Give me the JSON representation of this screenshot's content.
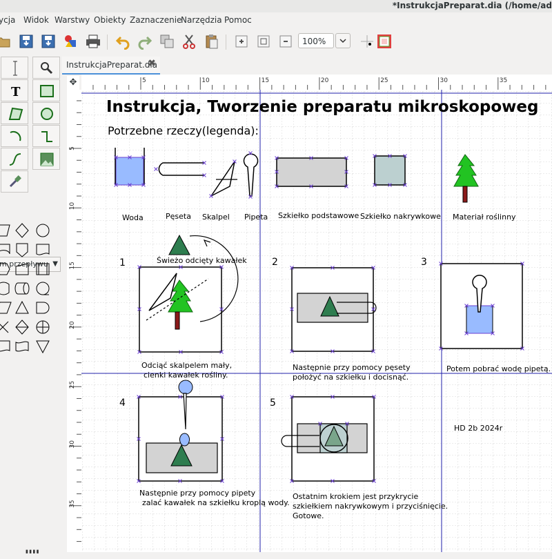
{
  "window": {
    "title": "*InstrukcjaPreparat.dia (/home/ad"
  },
  "menu": [
    "ycja",
    "Widok",
    "Warstwy",
    "Obiekty",
    "Zaznaczenie",
    "Narzędzia",
    "Pomoc"
  ],
  "toolbar": {
    "zoom_value": "100%"
  },
  "toolbox": {
    "sheet_label": "m przepływu"
  },
  "tabs": [
    {
      "label": "InstrukcjaPreparat.dia",
      "close": "✖"
    }
  ],
  "rulers": {
    "corner_icon": "✥",
    "h_ticks": [
      "5",
      "10",
      "15",
      "20",
      "25",
      "30",
      "35"
    ],
    "v_ticks": [
      "5",
      "10",
      "15",
      "20",
      "25",
      "30",
      "35"
    ]
  },
  "diagram": {
    "title": "Instrukcja, Tworzenie preparatu mikroskopoweg",
    "subtitle": "Potrzebne rzeczy(legenda):",
    "legend": {
      "water": "Woda",
      "tweezers": "Pęseta",
      "scalpel": "Skalpel",
      "pipette": "Pipeta",
      "slide": "Szkiełko podstawowe",
      "cover": "Szkiełko nakrywkowe",
      "plant": "Materiał roślinny"
    },
    "steps": [
      {
        "num": "1",
        "note": "Świeżo odcięty kawałek",
        "lines": [
          "Odciąć skalpelem mały,",
          "cienki kawałek rośliny."
        ]
      },
      {
        "num": "2",
        "lines": [
          "Następnie przy pomocy pęsety",
          "położyć na szkiełku i docisnąć."
        ]
      },
      {
        "num": "3",
        "lines": [
          "Potem pobrać wodę pipetą."
        ]
      },
      {
        "num": "4",
        "lines": [
          "Następnie przy pomocy pipety",
          "zalać kawałek na szkiełku kroplą wody."
        ]
      },
      {
        "num": "5",
        "lines": [
          "Ostatnim krokiem jest przykrycie",
          "szkiełkiem nakrywkowym i przyciśnięcie.",
          "Gotowe."
        ]
      }
    ],
    "signature": "HD 2b 2024r"
  },
  "colors": {
    "water": "#99bbff",
    "glass": "#d3d3d3",
    "cover": "#bcd0d0",
    "tree": "#2e7d4f",
    "tree_light": "#22c322",
    "trunk": "#8b1a1a",
    "select": "#6a3fd1",
    "guide": "#1f1faa"
  },
  "icons": [
    "open-icon",
    "save-icon",
    "save-as-icon",
    "export-icon",
    "print-icon",
    "undo-icon",
    "redo-icon",
    "copy-icon",
    "cut-icon",
    "paste-icon",
    "zoom-in-icon",
    "zoom-fit-icon",
    "zoom-out-icon",
    "snap-grid-icon",
    "color-icon"
  ]
}
